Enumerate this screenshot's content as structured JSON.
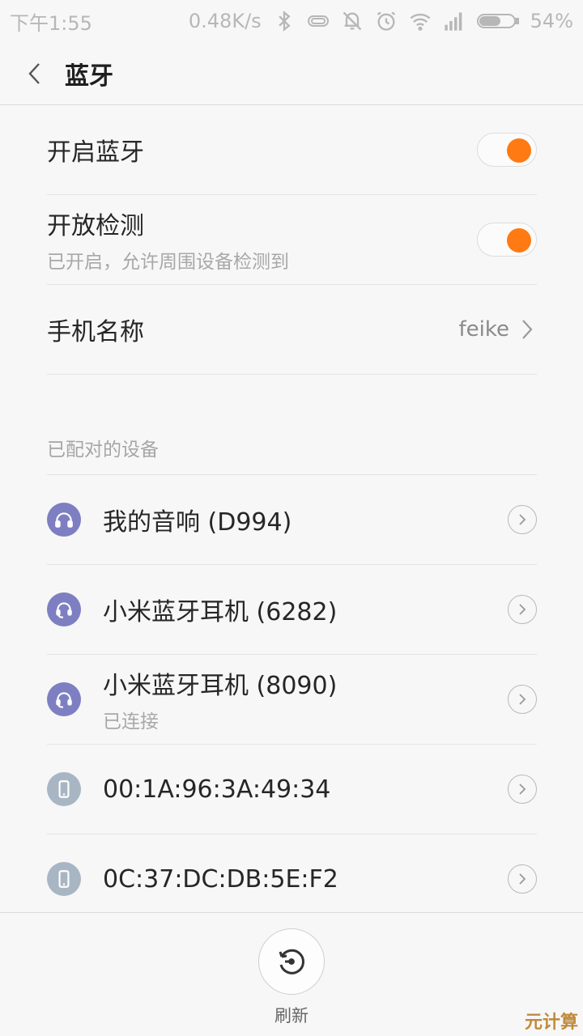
{
  "status_bar": {
    "time": "下午1:55",
    "net_speed": "0.48K/s",
    "battery": "54%",
    "icons": [
      "bluetooth-icon",
      "vr-icon",
      "vibrate-off-icon",
      "alarm-icon",
      "wifi-icon",
      "signal-icon",
      "battery-icon"
    ]
  },
  "header": {
    "title": "蓝牙"
  },
  "settings": {
    "bluetooth": {
      "label": "开启蓝牙",
      "enabled": true
    },
    "discoverable": {
      "label": "开放检测",
      "sub": "已开启，允许周围设备检测到",
      "enabled": true
    },
    "phone_name": {
      "label": "手机名称",
      "value": "feike"
    }
  },
  "paired_section": {
    "title": "已配对的设备",
    "devices": [
      {
        "name": "我的音响 (D994)",
        "status": "",
        "icon": "headphones-icon"
      },
      {
        "name": "小米蓝牙耳机 (6282)",
        "status": "",
        "icon": "headset-icon"
      },
      {
        "name": "小米蓝牙耳机 (8090)",
        "status": "已连接",
        "icon": "headset-icon"
      },
      {
        "name": "00:1A:96:3A:49:34",
        "status": "",
        "icon": "phone-icon"
      },
      {
        "name": "0C:37:DC:DB:5E:F2",
        "status": "",
        "icon": "phone-icon"
      }
    ]
  },
  "bottom": {
    "refresh_label": "刷新"
  },
  "watermark": "元计算",
  "colors": {
    "accent": "#ff7a12",
    "device_purple": "#7e7fc2",
    "device_grey": "#a8b6c4"
  }
}
